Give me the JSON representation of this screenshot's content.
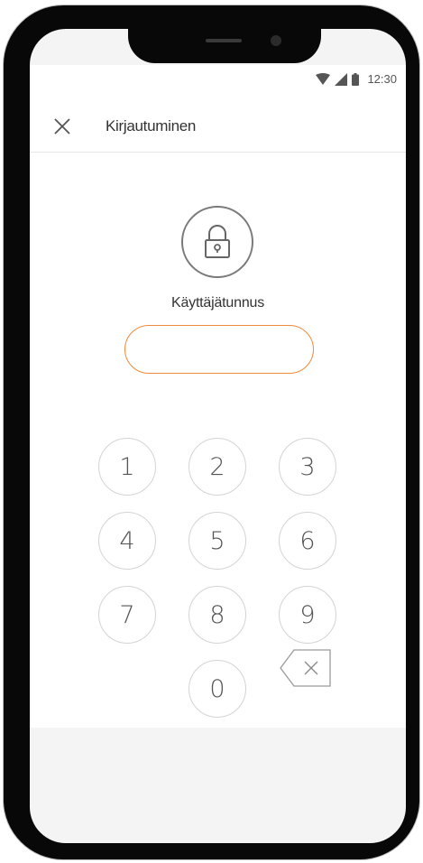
{
  "status_bar": {
    "time": "12:30",
    "icons": [
      "wifi-icon",
      "signal-icon",
      "battery-icon"
    ]
  },
  "header": {
    "title": "Kirjautuminen",
    "close_icon": "close-icon"
  },
  "login": {
    "lock_icon": "lock-icon",
    "username_label": "Käyttäjätunnus",
    "username_value": "",
    "username_placeholder": ""
  },
  "keypad": {
    "keys": [
      "1",
      "2",
      "3",
      "4",
      "5",
      "6",
      "7",
      "8",
      "9",
      "0"
    ],
    "backspace_icon": "backspace-icon"
  },
  "colors": {
    "accent": "#ef8a3c",
    "frame": "#080808",
    "text": "#333333",
    "key_border": "#d4d4d4"
  }
}
